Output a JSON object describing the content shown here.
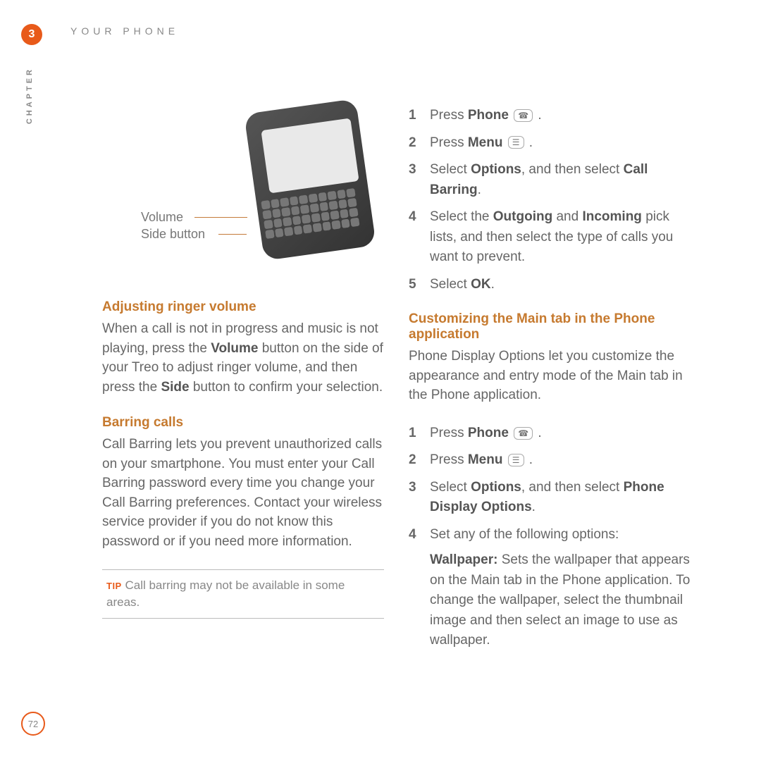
{
  "header": {
    "chapter_number": "3",
    "title": "YOUR PHONE",
    "chapter_vert": "CHAPTER",
    "page_number": "72"
  },
  "diagram": {
    "label_volume": "Volume",
    "label_side": "Side button"
  },
  "left_column": {
    "heading1": "Adjusting ringer volume",
    "para1_a": "When a call is not in progress and music is not playing, press the ",
    "para1_b": " button on the side of your Treo to adjust ringer volume, and then press the ",
    "para1_c": " button to confirm your selection.",
    "bold_volume": "Volume",
    "bold_side": "Side",
    "heading2": "Barring calls",
    "para2": "Call Barring lets you prevent unauthorized calls on your smartphone. You must enter your Call Barring password every time you change your Call Barring preferences. Contact your wireless service provider if you do not know this password or if you need more information.",
    "tip_label": "TIP",
    "tip_text": " Call barring may not be available in some areas."
  },
  "right_column": {
    "steps_a": {
      "s1_pre": "Press ",
      "s1_bold": "Phone",
      "s1_post": " .",
      "s2_pre": "Press ",
      "s2_bold": "Menu",
      "s2_post": " .",
      "s3_pre": "Select ",
      "s3_bold1": "Options",
      "s3_mid": ", and then select ",
      "s3_bold2": "Call Barring",
      "s3_post": ".",
      "s4_pre": "Select the ",
      "s4_bold1": "Outgoing",
      "s4_mid1": " and ",
      "s4_bold2": "Incoming",
      "s4_mid2": " pick lists, and then select the type of calls you want to prevent.",
      "s5_pre": "Select ",
      "s5_bold": "OK",
      "s5_post": "."
    },
    "heading3": "Customizing the Main tab in the Phone application",
    "para3": "Phone Display Options let you customize the appearance and entry mode of the Main tab in the Phone application.",
    "steps_b": {
      "s1_pre": "Press ",
      "s1_bold": "Phone",
      "s1_post": " .",
      "s2_pre": "Press ",
      "s2_bold": "Menu",
      "s2_post": " .",
      "s3_pre": "Select ",
      "s3_bold1": "Options",
      "s3_mid": ", and then select ",
      "s3_bold2": "Phone Display Options",
      "s3_post": ".",
      "s4_pre": "Set any of the following options:",
      "s4_sub_bold": "Wallpaper:",
      "s4_sub_text": " Sets the wallpaper that appears on the Main tab in the Phone application. To change the wallpaper, select the thumbnail image and then select an image to use as wallpaper."
    }
  }
}
